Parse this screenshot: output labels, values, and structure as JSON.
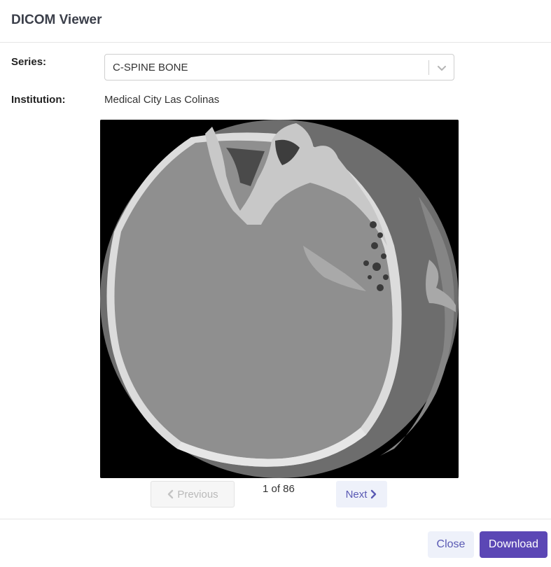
{
  "header": {
    "title": "DICOM Viewer"
  },
  "series": {
    "label": "Series:",
    "selected": "C-SPINE BONE"
  },
  "institution": {
    "label": "Institution:",
    "value": "Medical City Las Colinas"
  },
  "viewer": {
    "image": "ct-head-axial-slice"
  },
  "pager": {
    "previous_label": "Previous",
    "status": "1 of 86",
    "next_label": "Next"
  },
  "footer": {
    "close_label": "Close",
    "download_label": "Download"
  },
  "colors": {
    "primary": "#5b47b5",
    "secondary_bg": "#eef1fa",
    "secondary_text": "#5a5ab4"
  }
}
